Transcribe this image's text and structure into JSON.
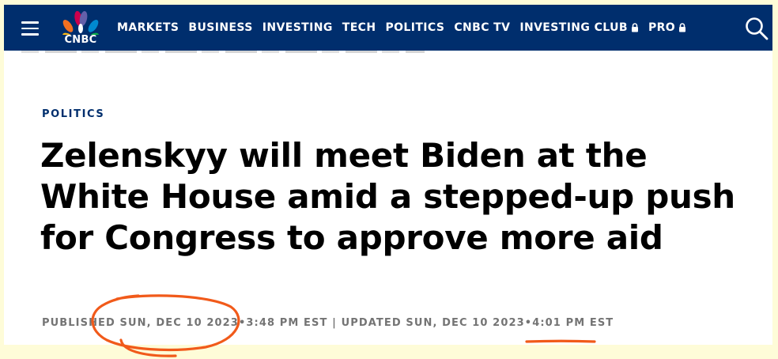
{
  "nav": {
    "menu_icon": "hamburger-menu-icon",
    "logo_text": "CNBC",
    "logo_colors": [
      "#fdb913",
      "#f37021",
      "#cc004c",
      "#6460aa",
      "#0089d0",
      "#0db14b"
    ],
    "links": [
      "MARKETS",
      "BUSINESS",
      "INVESTING",
      "TECH",
      "POLITICS",
      "CNBC TV",
      "INVESTING CLUB",
      "PRO"
    ],
    "search_icon": "search-icon",
    "background": "#002e6d"
  },
  "article": {
    "category": "POLITICS",
    "headline": "Zelenskyy will meet Biden at the White House amid a stepped-up push for Congress to approve more aid",
    "published_label": "PUBLISHED SUN, DEC 10 2023",
    "published_time": "3:48 PM EST",
    "separator": "|",
    "updated_label": "UPDATED SUN, DEC 10 2023",
    "updated_time": "4:01 PM EST"
  },
  "annotation_color": "#f15a1a"
}
